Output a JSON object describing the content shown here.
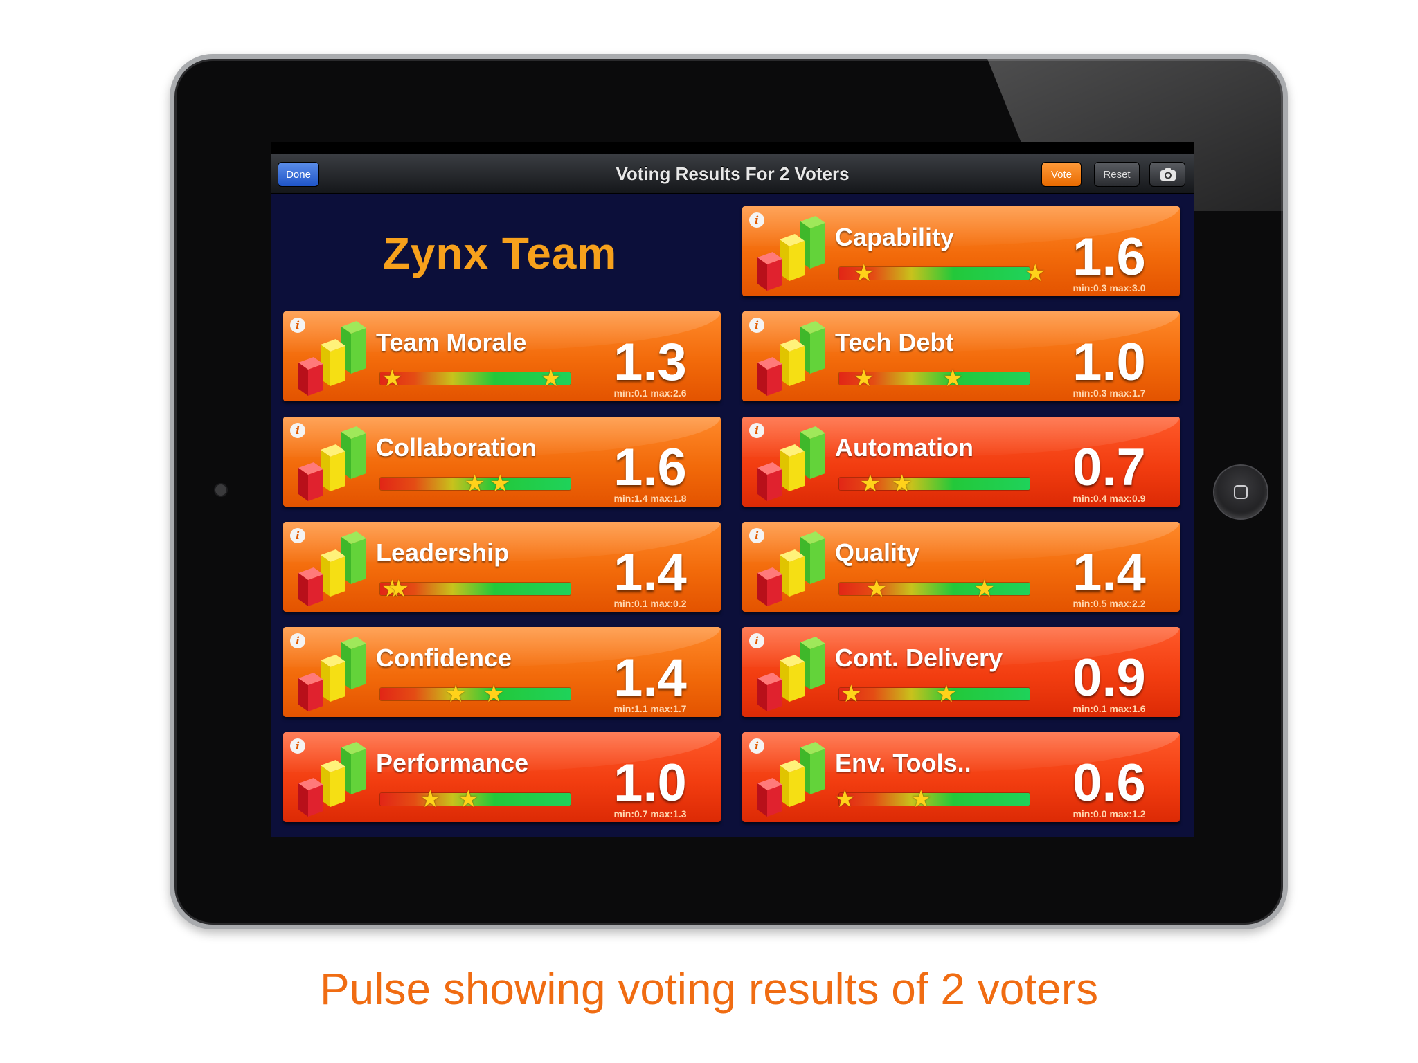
{
  "nav": {
    "title": "Voting Results For 2 Voters",
    "done_label": "Done",
    "vote_label": "Vote",
    "reset_label": "Reset",
    "camera_icon": "camera-icon"
  },
  "team_name": "Zynx Team",
  "colors": {
    "team_name": "#f7a11c",
    "caption": "#f06c12",
    "vote_button": "#f58a1f",
    "done_button": "#2f6ee0"
  },
  "metrics": [
    {
      "label": "Capability",
      "score": "1.6",
      "minmax": "min:0.3 max:3.0",
      "range_min": 0.3,
      "range_max": 3.0,
      "tone": "orange"
    },
    {
      "label": "Team Morale",
      "score": "1.3",
      "minmax": "min:0.1 max:2.6",
      "range_min": 0.1,
      "range_max": 2.6,
      "tone": "orange"
    },
    {
      "label": "Tech Debt",
      "score": "1.0",
      "minmax": "min:0.3 max:1.7",
      "range_min": 0.3,
      "range_max": 1.7,
      "tone": "orange"
    },
    {
      "label": "Collaboration",
      "score": "1.6",
      "minmax": "min:1.4 max:1.8",
      "range_min": 1.4,
      "range_max": 1.8,
      "tone": "orange"
    },
    {
      "label": "Automation",
      "score": "0.7",
      "minmax": "min:0.4 max:0.9",
      "range_min": 0.4,
      "range_max": 0.9,
      "tone": "red"
    },
    {
      "label": "Leadership",
      "score": "1.4",
      "minmax": "min:0.1 max:0.2",
      "range_min": 0.1,
      "range_max": 0.2,
      "tone": "orange"
    },
    {
      "label": "Quality",
      "score": "1.4",
      "minmax": "min:0.5 max:2.2",
      "range_min": 0.5,
      "range_max": 2.2,
      "tone": "orange"
    },
    {
      "label": "Confidence",
      "score": "1.4",
      "minmax": "min:1.1 max:1.7",
      "range_min": 1.1,
      "range_max": 1.7,
      "tone": "orange"
    },
    {
      "label": "Cont. Delivery",
      "score": "0.9",
      "minmax": "min:0.1 max:1.6",
      "range_min": 0.1,
      "range_max": 1.6,
      "tone": "red"
    },
    {
      "label": "Performance",
      "score": "1.0",
      "minmax": "min:0.7 max:1.3",
      "range_min": 0.7,
      "range_max": 1.3,
      "tone": "red"
    },
    {
      "label": "Env. Tools..",
      "score": "0.6",
      "minmax": "min:0.0 max:1.2",
      "range_min": 0.0,
      "range_max": 1.2,
      "tone": "red"
    }
  ],
  "scale_max": 3.0,
  "caption": "Pulse showing voting results of 2 voters"
}
